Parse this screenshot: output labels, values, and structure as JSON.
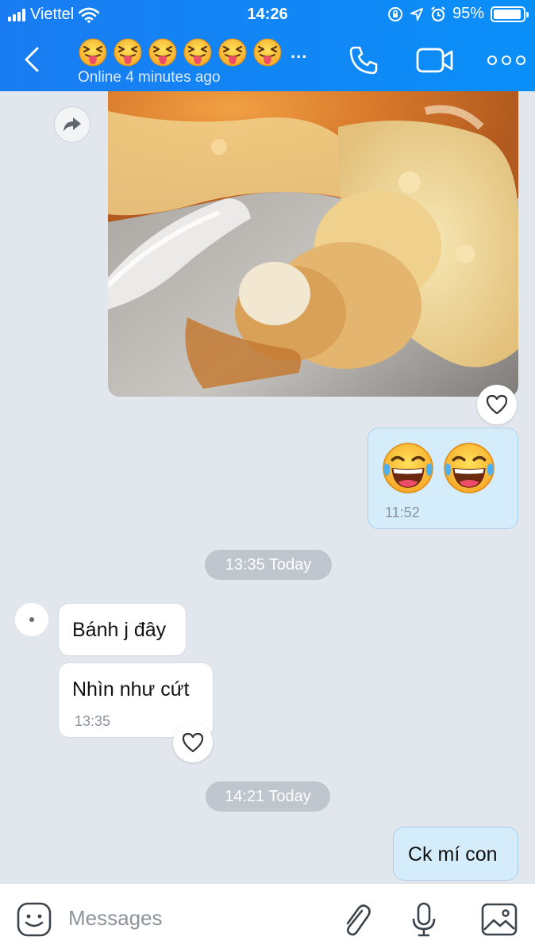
{
  "status_bar": {
    "carrier": "Viettel",
    "time": "14:26",
    "battery": "95%"
  },
  "header": {
    "title_emoji_count": 6,
    "title_more": "...",
    "subtitle": "Online 4 minutes ago",
    "icons": [
      "back-arrow-icon",
      "phone-icon",
      "video-camera-icon",
      "more-dots-icon"
    ]
  },
  "messages": {
    "photo_description_icon": "cake-photo",
    "emoji_msg": {
      "emojis": [
        "😂",
        "😂"
      ],
      "time": "11:52"
    },
    "divider_1": "13:35 Today",
    "incoming_1": "Bánh j đây",
    "incoming_2": {
      "text": "Nhìn như cứt",
      "time": "13:35"
    },
    "divider_2": "14:21 Today",
    "outgoing_last": "Ck mí con"
  },
  "composer": {
    "placeholder": "Messages"
  },
  "colors": {
    "header": "#1a7cf2",
    "background": "#e2e7ee",
    "outgoing_bubble": "#d5edfb"
  }
}
